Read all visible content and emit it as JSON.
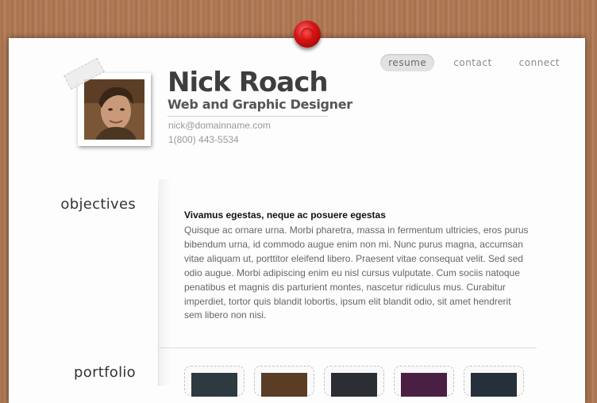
{
  "nav": {
    "items": [
      "resume",
      "contact",
      "connect"
    ],
    "active": "resume"
  },
  "profile": {
    "name": "Nick Roach",
    "title": "Web and Graphic Designer",
    "email": "nick@domainname.com",
    "phone": "1(800) 443-5534"
  },
  "sections": {
    "objectives": {
      "label": "objectives",
      "heading": "Vivamus egestas, neque ac posuere egestas",
      "body": "Quisque ac ornare urna. Morbi pharetra, massa in fermentum ultricies, eros purus bibendum urna, id commodo augue enim non mi. Nunc purus magna, accumsan vitae aliquam ut, porttitor eleifend libero. Praesent vitae consequat velit. Sed sed odio augue. Morbi adipiscing enim eu nisl cursus vulputate. Cum sociis natoque penatibus et magnis dis parturient montes, nascetur ridiculus mus. Curabitur imperdiet, tortor quis blandit lobortis, ipsum elit blandit odio, sit amet hendrerit sem libero non nisi."
    },
    "portfolio": {
      "label": "portfolio",
      "thumbnails": [
        {
          "color": "#2d3a40"
        },
        {
          "color": "#5a3d24"
        },
        {
          "color": "#2b2f33"
        },
        {
          "color": "#4a1f44"
        },
        {
          "color": "#26303a"
        }
      ]
    }
  },
  "colors": {
    "pin": "#d81616",
    "wood": "#b07a54",
    "paper": "#fdfdfd"
  }
}
